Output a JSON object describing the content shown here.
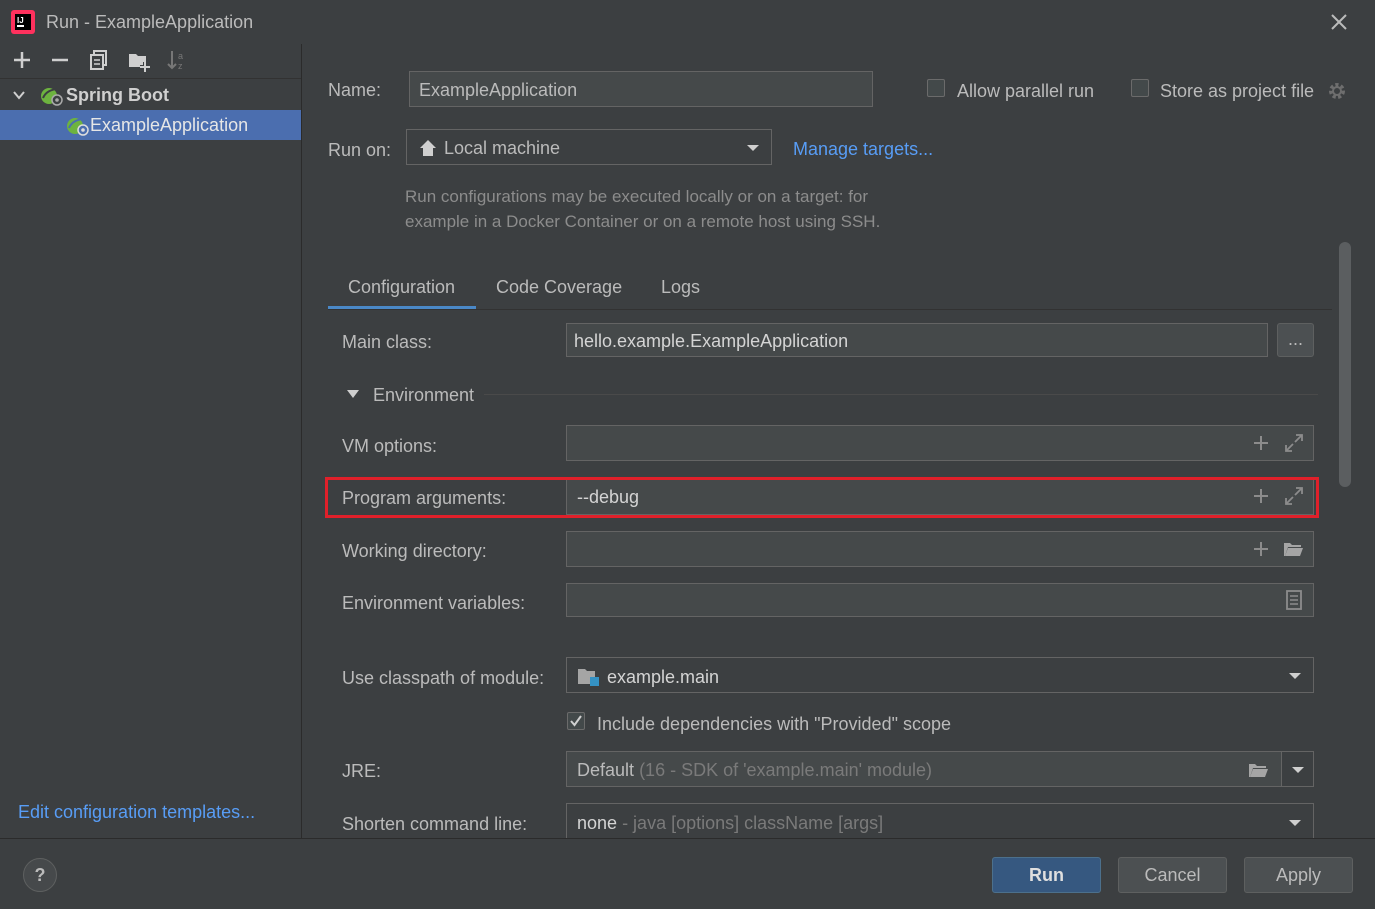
{
  "window": {
    "title": "Run - ExampleApplication"
  },
  "toolbar": {
    "icons": [
      "add-icon",
      "remove-icon",
      "copy-icon",
      "new-folder-icon",
      "sort-icon"
    ]
  },
  "tree": {
    "group_label": "Spring Boot",
    "item_label": "ExampleApplication"
  },
  "left_footer": {
    "templates_link": "Edit configuration templates..."
  },
  "form": {
    "name_label": "Name:",
    "name_value": "ExampleApplication",
    "allow_parallel_label": "Allow parallel run",
    "store_project_label": "Store as project file",
    "run_on_label": "Run on:",
    "run_on_value": "Local machine",
    "manage_targets": "Manage targets...",
    "hint_line1": "Run configurations may be executed locally or on a target: for",
    "hint_line2": "example in a Docker Container or on a remote host using SSH."
  },
  "tabs": [
    {
      "label": "Configuration",
      "active": true
    },
    {
      "label": "Code Coverage",
      "active": false
    },
    {
      "label": "Logs",
      "active": false
    }
  ],
  "config": {
    "main_class_label": "Main class:",
    "main_class_value": "hello.example.ExampleApplication",
    "browse_label": "...",
    "environment_label": "Environment",
    "vm_options_label": "VM options:",
    "program_args_label": "Program arguments:",
    "program_args_value": "--debug",
    "working_dir_label": "Working directory:",
    "env_vars_label": "Environment variables:",
    "classpath_label": "Use classpath of module:",
    "classpath_value": "example.main",
    "include_deps_label": "Include dependencies with \"Provided\" scope",
    "include_deps_checked": true,
    "jre_label": "JRE:",
    "jre_value": "Default",
    "jre_detail": "(16 - SDK of 'example.main' module)",
    "shorten_label": "Shorten command line:",
    "shorten_value": "none",
    "shorten_detail": "- java [options] className [args]"
  },
  "buttons": {
    "run": "Run",
    "cancel": "Cancel",
    "apply": "Apply",
    "help": "?"
  },
  "colors": {
    "accent": "#4a88c7",
    "link": "#589df6",
    "highlight": "#e0202a",
    "selection": "#4b6eaf",
    "spring_green": "#6db33f"
  }
}
